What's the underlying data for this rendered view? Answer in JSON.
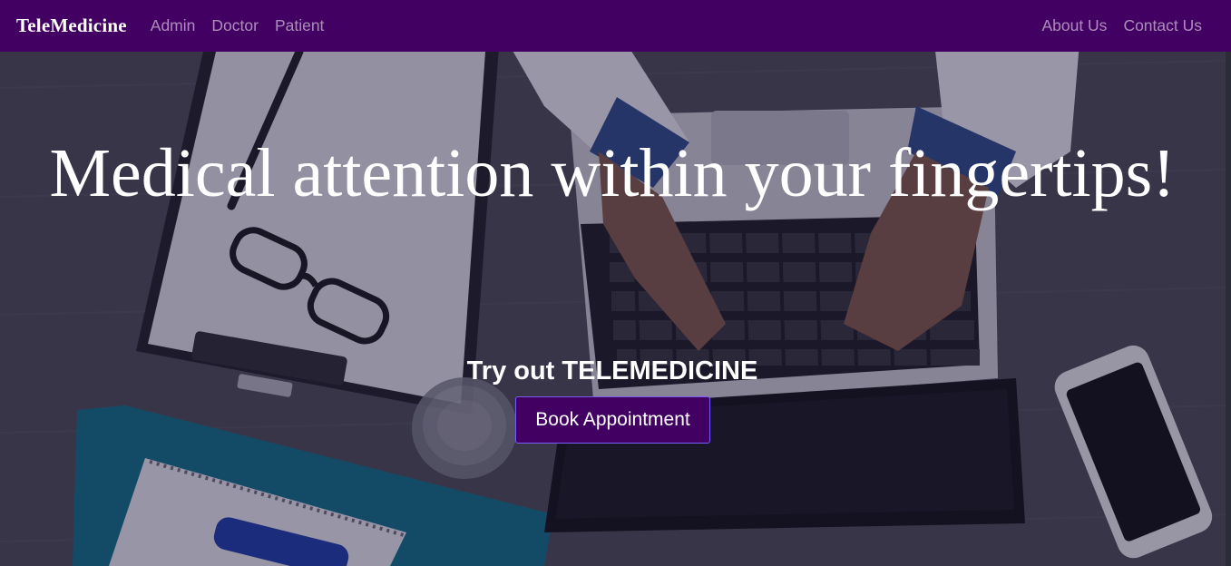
{
  "navbar": {
    "brand": "TeleMedicine",
    "left_links": [
      "Admin",
      "Doctor",
      "Patient"
    ],
    "right_links": [
      "About Us",
      "Contact Us"
    ]
  },
  "hero": {
    "title": "Medical attention within your fingertips!",
    "cta_text": "Try out TELEMEDICINE",
    "cta_button": "Book Appointment",
    "background_scene": "doctor typing on laptop at desk with clipboard, glasses, water glass, notebook and smartphone"
  },
  "colors": {
    "navbar_bg": "#420062",
    "button_bg": "#420062",
    "text": "#ffffff"
  }
}
